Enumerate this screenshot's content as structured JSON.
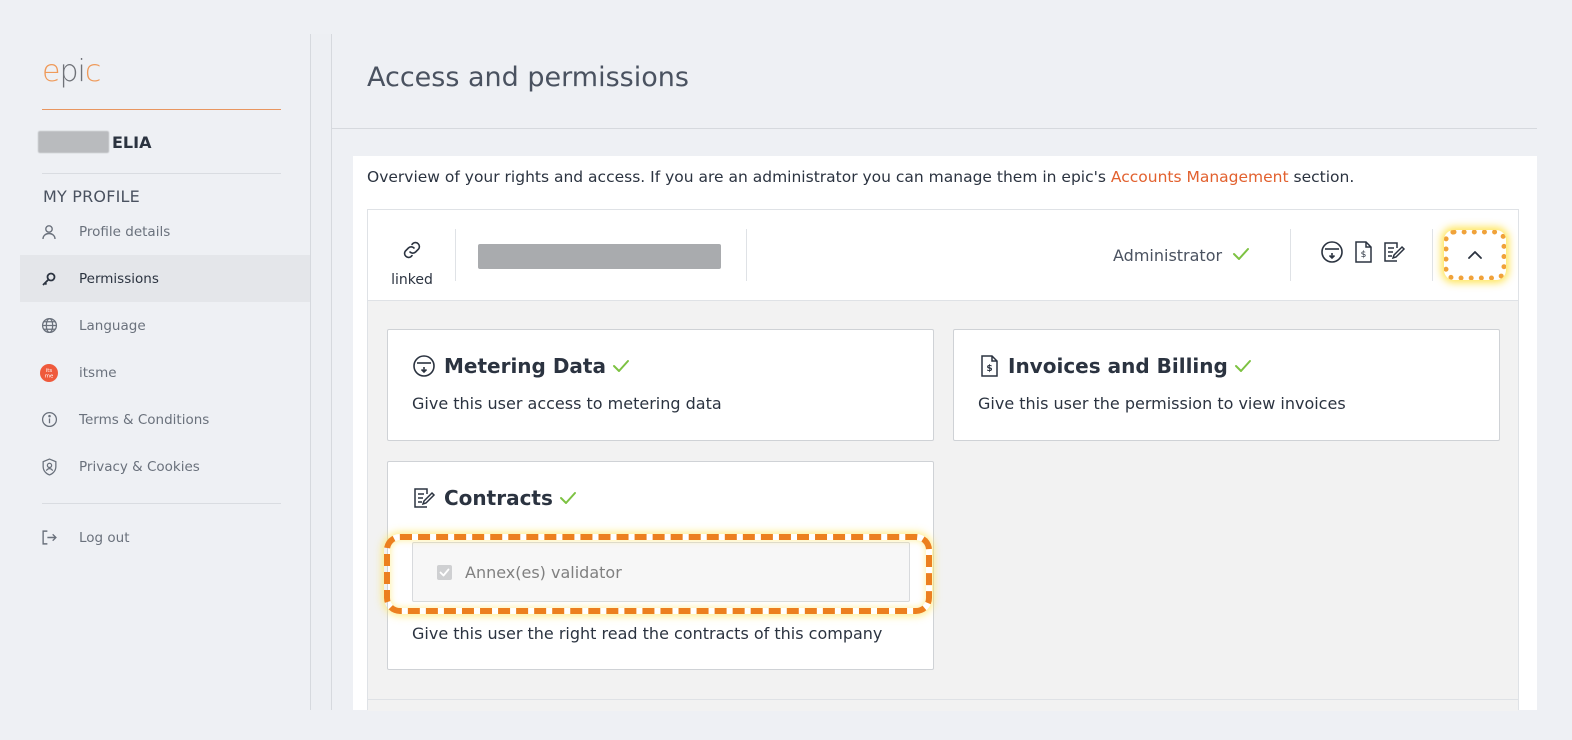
{
  "sidebar": {
    "logo": {
      "e": "e",
      "middle": "pi",
      "c": "c"
    },
    "user_name": "ELIA",
    "section_title": "MY PROFILE",
    "items": [
      {
        "label": "Profile details",
        "icon": "user-icon"
      },
      {
        "label": "Permissions",
        "icon": "key-icon"
      },
      {
        "label": "Language",
        "icon": "globe-icon"
      },
      {
        "label": "itsme",
        "icon": "itsme-icon"
      },
      {
        "label": "Terms & Conditions",
        "icon": "info-icon"
      },
      {
        "label": "Privacy & Cookies",
        "icon": "shield-icon"
      }
    ],
    "logout_label": "Log out",
    "active_item": "Permissions"
  },
  "main": {
    "title": "Access and permissions",
    "overview_before": "Overview of your rights and access. If you are an administrator you can manage them in epic's ",
    "overview_link": "Accounts Management",
    "overview_after": " section."
  },
  "account": {
    "link_label": "linked",
    "role": "Administrator",
    "permission_icons": [
      "metering-icon",
      "invoice-icon",
      "contract-icon"
    ]
  },
  "cards": {
    "metering": {
      "title": "Metering Data",
      "description": "Give this user access to metering data"
    },
    "invoices": {
      "title": "Invoices and Billing",
      "description": "Give this user the permission to view invoices"
    },
    "contracts": {
      "title": "Contracts",
      "option_label": "Annex(es) validator",
      "option_checked": true,
      "description": "Give this user the right read the contracts of this company"
    }
  },
  "colors": {
    "accent": "#e2612f",
    "check": "#7dc242",
    "highlight": "#ec7f1f"
  }
}
